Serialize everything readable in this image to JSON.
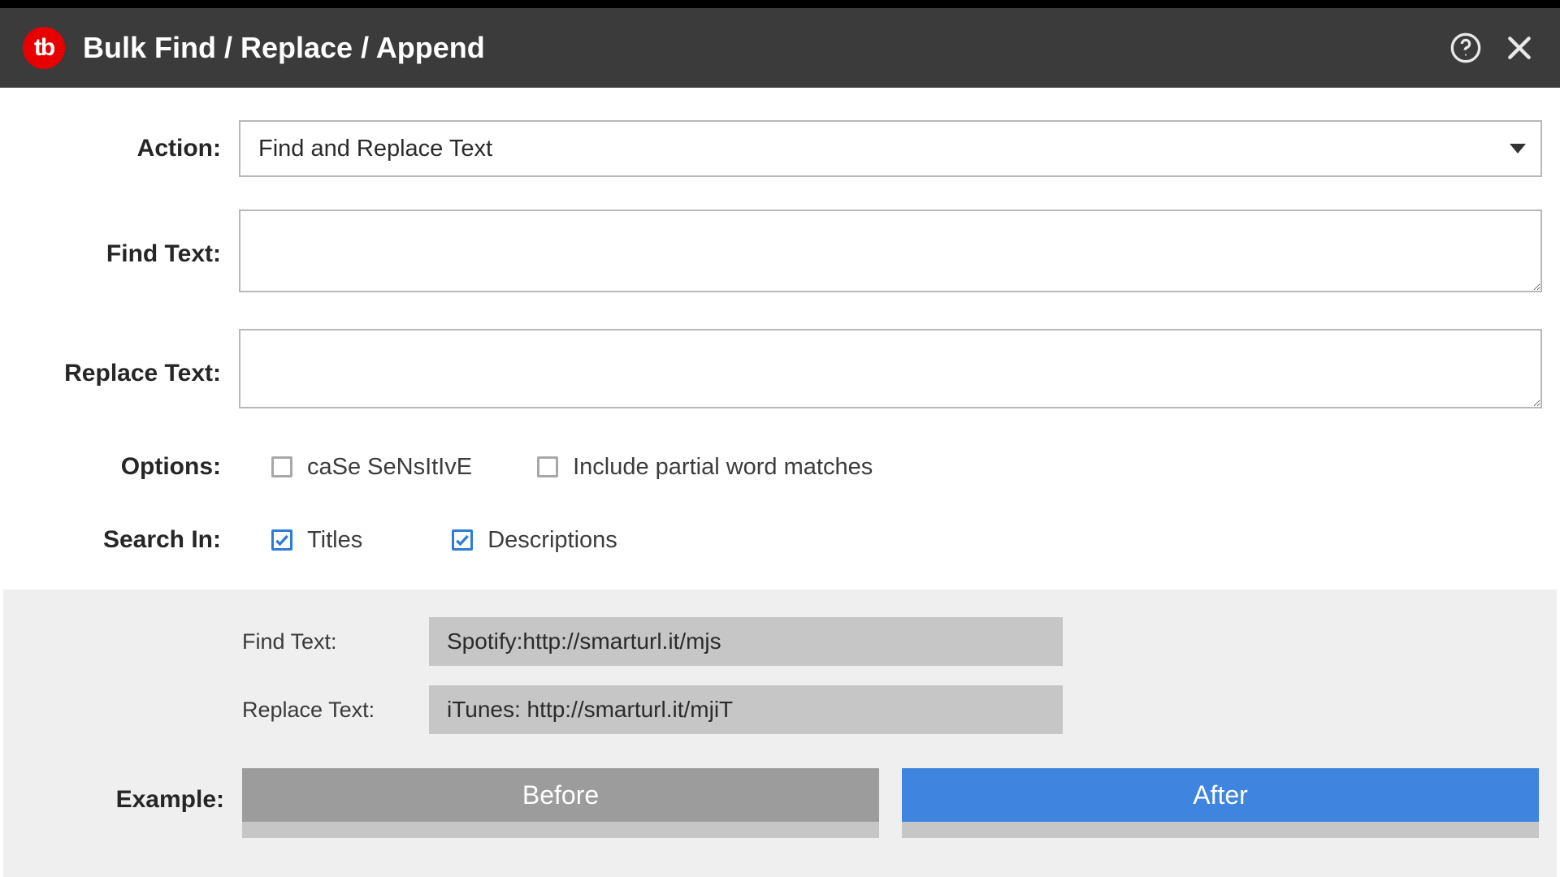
{
  "header": {
    "logo_text": "tb",
    "title": "Bulk Find / Replace / Append"
  },
  "form": {
    "action": {
      "label": "Action:",
      "value": "Find and Replace Text"
    },
    "find": {
      "label": "Find Text:",
      "value": ""
    },
    "replace": {
      "label": "Replace Text:",
      "value": ""
    },
    "options": {
      "label": "Options:",
      "case_sensitive": {
        "label": "caSe SeNsItIvE",
        "checked": false
      },
      "partial": {
        "label": "Include partial word matches",
        "checked": false
      }
    },
    "search_in": {
      "label": "Search In:",
      "titles": {
        "label": "Titles",
        "checked": true
      },
      "descriptions": {
        "label": "Descriptions",
        "checked": true
      }
    }
  },
  "example": {
    "label": "Example:",
    "find_label": "Find Text:",
    "find_value": "Spotify:http://smarturl.it/mjs",
    "replace_label": "Replace Text:",
    "replace_value": "iTunes: http://smarturl.it/mjiT",
    "before_label": "Before",
    "after_label": "After"
  }
}
